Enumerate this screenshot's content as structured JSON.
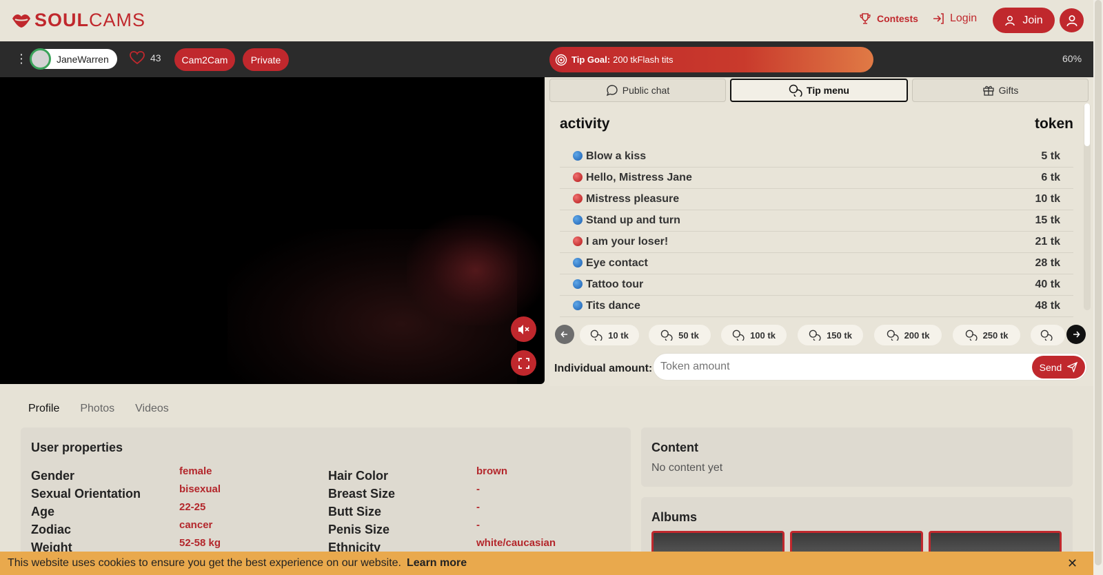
{
  "header": {
    "logo_bold": "SOUL",
    "logo_light": "CAMS",
    "contests": "Contests",
    "login": "Login",
    "join": "Join"
  },
  "streambar": {
    "model_name": "JaneWarren",
    "likes": "43",
    "cam2cam": "Cam2Cam",
    "private": "Private",
    "tip_goal_label": "Tip Goal:",
    "tip_goal_amount": "200 tk",
    "tip_goal_text": "Flash tits",
    "tip_goal_progress": 0.6,
    "progress_text": "60%"
  },
  "tabs": [
    {
      "label": "Public chat",
      "icon": "chat-bubble-icon",
      "active": false
    },
    {
      "label": "Tip menu",
      "icon": "coins-icon",
      "active": true
    },
    {
      "label": "Gifts",
      "icon": "gift-icon",
      "active": false
    }
  ],
  "tip_menu": {
    "col_activity": "activity",
    "col_token": "token",
    "items": [
      {
        "name": "Blow a kiss",
        "price": "5 tk",
        "dot": "blue"
      },
      {
        "name": "Hello, Mistress Jane",
        "price": "6 tk",
        "dot": "red"
      },
      {
        "name": "Mistress pleasure",
        "price": "10 tk",
        "dot": "red"
      },
      {
        "name": "Stand up and turn",
        "price": "15 tk",
        "dot": "blue"
      },
      {
        "name": "I am your loser!",
        "price": "21 tk",
        "dot": "red"
      },
      {
        "name": "Eye contact",
        "price": "28 tk",
        "dot": "blue"
      },
      {
        "name": "Tattoo tour",
        "price": "40 tk",
        "dot": "blue"
      },
      {
        "name": "Tits dance",
        "price": "48 tk",
        "dot": "blue"
      }
    ]
  },
  "chips": [
    "10 tk",
    "50 tk",
    "100 tk",
    "150 tk",
    "200 tk",
    "250 tk"
  ],
  "individual": {
    "label": "Individual amount:",
    "placeholder": "Token amount",
    "send": "Send"
  },
  "profile_tabs": [
    "Profile",
    "Photos",
    "Videos"
  ],
  "user_properties": {
    "title": "User properties",
    "left": [
      {
        "key": "Gender",
        "value": "female"
      },
      {
        "key": "Sexual Orientation",
        "value": "bisexual"
      },
      {
        "key": "Age",
        "value": "22-25"
      },
      {
        "key": "Zodiac",
        "value": "cancer"
      },
      {
        "key": "Weight",
        "value": "52-58 kg"
      }
    ],
    "right": [
      {
        "key": "Hair Color",
        "value": "brown"
      },
      {
        "key": "Breast Size",
        "value": "-"
      },
      {
        "key": "Butt Size",
        "value": "-"
      },
      {
        "key": "Penis Size",
        "value": "-"
      },
      {
        "key": "Ethnicity",
        "value": "white/caucasian"
      }
    ]
  },
  "content": {
    "title": "Content",
    "empty": "No content yet"
  },
  "albums": {
    "title": "Albums"
  },
  "cookie": {
    "text": "This website uses cookies to ensure you get the best experience on our website.",
    "learn_more": "Learn more",
    "close": "✕"
  },
  "colors": {
    "brand": "#c0282d",
    "header_bg": "#e8e4d8",
    "streambar_bg": "#2b2b2b",
    "cookie_bg": "#e9a94d"
  }
}
